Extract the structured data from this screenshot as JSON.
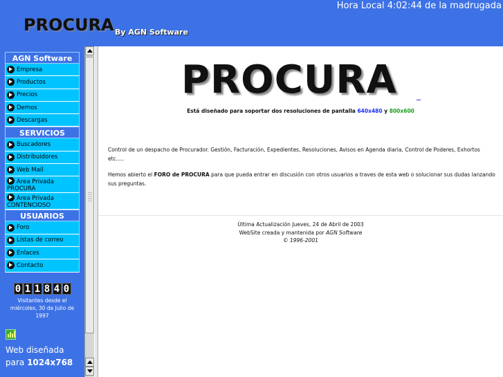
{
  "header": {
    "clock": "Hora Local 4:02:44 de la madrugada",
    "logo": "PROCURA",
    "byline": "By AGN Software"
  },
  "sidebar": {
    "section1": {
      "title": "AGN Software",
      "items": [
        "Empresa",
        "Productos",
        "Precios",
        "Demos",
        "Descargas"
      ]
    },
    "section2": {
      "title": "SERVICIOS",
      "items": [
        "Buscadores",
        "Distribuidores",
        "Web Mail",
        "Area Privada PROCURA",
        "Area Privada CONTENCIOSO"
      ]
    },
    "section3": {
      "title": "USUARIOS",
      "items": [
        "Foro",
        "Listas de correo",
        "Enlaces",
        "Contacto"
      ]
    },
    "counter": {
      "digits": [
        "0",
        "1",
        "1",
        "8",
        "4",
        "0"
      ],
      "text": "Visitantes desde el miércoles, 30 de Julio de 1997"
    },
    "web_design": {
      "line1": "Web diseñada",
      "line2_prefix": "para ",
      "line2_bold": "1024x768"
    }
  },
  "main": {
    "logo": "PROCURA",
    "resolutions": {
      "prefix": "Está diseñado para soportar dos resoluciones de pantalla ",
      "res1": "640x480",
      "mid": " y ",
      "res2": "800x600"
    },
    "description": "Control de un despacho de Procurador. Gestión, Facturación, Expedientes, Resoluciones, Avisos en Agenda diaria, Control de Poderes, Exhortos etc.....",
    "foro": {
      "prefix": "Hemos abierto el ",
      "bold": "FORO de PROCURA",
      "suffix": " para que pueda entrar en discusión con otros usuarios a traves de esta web o solucionar sus dudas lanzando sus preguntas."
    },
    "footer": {
      "updated": "Última Actualización Jueves, 24 de Abril de 2003",
      "created_prefix": "WebSite creada y mantenida por ",
      "created_by": "AGN Software",
      "copyright": "© 1996-2001"
    }
  }
}
